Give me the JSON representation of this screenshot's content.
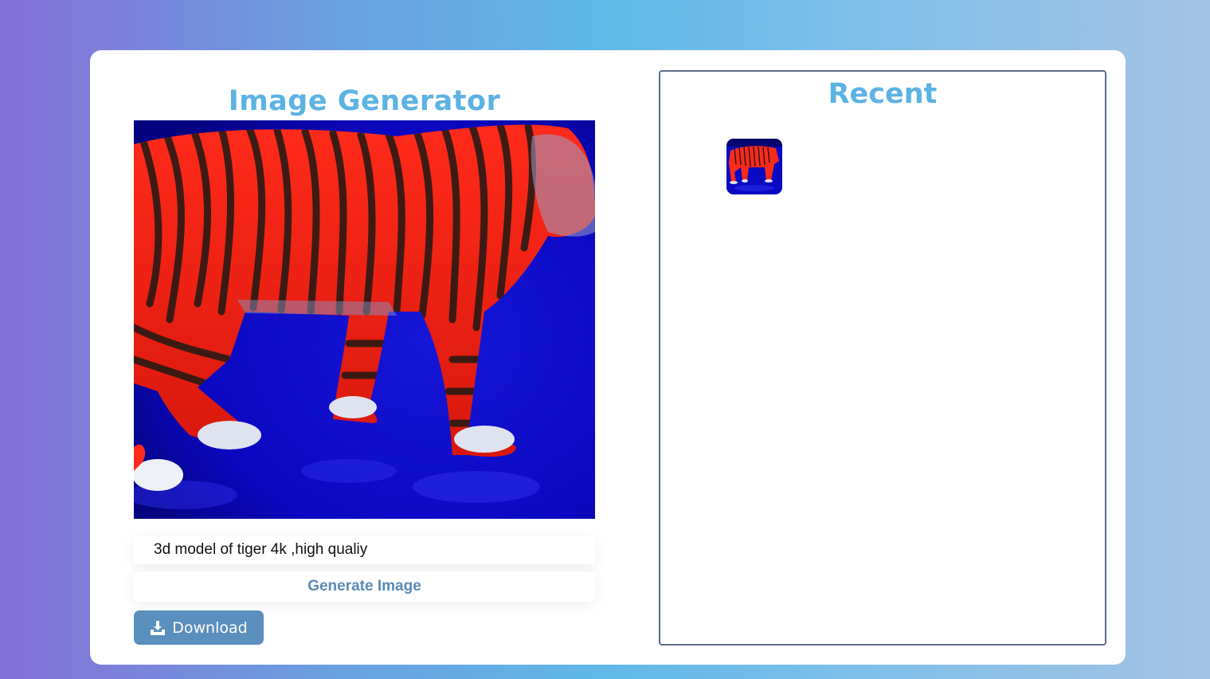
{
  "generator": {
    "title": "Image Generator",
    "prompt_value": "3d model of tiger 4k ,high qualiy",
    "prompt_placeholder": "",
    "generate_label": "Generate Image",
    "download_label": "Download",
    "download_icon": "download-icon",
    "image_subject": "red striped tiger on blue background"
  },
  "recent": {
    "title": "Recent",
    "thumbnails": [
      {
        "subject": "red striped tiger on blue background"
      }
    ]
  },
  "colors": {
    "accent_title": "#5cb2e3",
    "button_blue": "#5b8fbe",
    "generate_text": "#5a8bb5",
    "panel_border": "#5c6e8a"
  }
}
